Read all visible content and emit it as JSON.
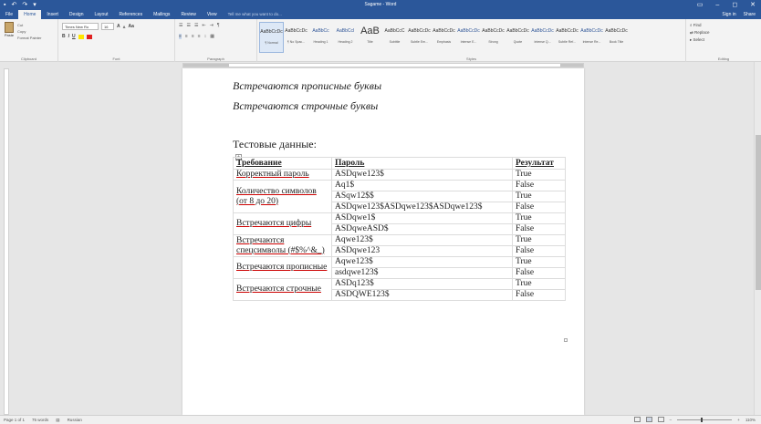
{
  "window": {
    "title": "Sagame - Word",
    "quick_access": [
      "▪",
      "↶",
      "↷",
      "▾"
    ],
    "account": {
      "sign_in": "Sign in",
      "share": "Share"
    },
    "controls": [
      "▭",
      "–",
      "◻",
      "✕"
    ]
  },
  "tabs": [
    "File",
    "Home",
    "Insert",
    "Design",
    "Layout",
    "References",
    "Mailings",
    "Review",
    "View"
  ],
  "active_tab": "Home",
  "tell_me_placeholder": "Tell me what you want to do...",
  "ribbon": {
    "clipboard": {
      "label": "Clipboard",
      "paste": "Paste",
      "cut": "Cut",
      "copy": "Copy",
      "format_painter": "Format Painter"
    },
    "font": {
      "label": "Font",
      "name": "Times New Ro",
      "size": "16",
      "grow": "A",
      "shrink": "A",
      "case": "Aa",
      "bold": "B",
      "italic": "I",
      "underline": "U"
    },
    "paragraph": {
      "label": "Paragraph",
      "pilcrow": "¶"
    },
    "styles": {
      "label": "Styles",
      "items": [
        {
          "preview": "AaBbCcDc",
          "name": "¶ Normal",
          "big": false,
          "blue": false
        },
        {
          "preview": "AaBbCcDc",
          "name": "¶ No Spac...",
          "big": false,
          "blue": false
        },
        {
          "preview": "AaBbCc",
          "name": "Heading 1",
          "big": false,
          "blue": true
        },
        {
          "preview": "AaBbCcI",
          "name": "Heading 2",
          "big": false,
          "blue": true
        },
        {
          "preview": "AaB",
          "name": "Title",
          "big": true,
          "blue": false
        },
        {
          "preview": "AaBbCcC",
          "name": "Subtitle",
          "big": false,
          "blue": false
        },
        {
          "preview": "AaBbCcDc",
          "name": "Subtle Em...",
          "big": false,
          "blue": false
        },
        {
          "preview": "AaBbCcDc",
          "name": "Emphasis",
          "big": false,
          "blue": false
        },
        {
          "preview": "AaBbCcDc",
          "name": "Intense E...",
          "big": false,
          "blue": true
        },
        {
          "preview": "AaBbCcDc",
          "name": "Strong",
          "big": false,
          "blue": false
        },
        {
          "preview": "AaBbCcDc",
          "name": "Quote",
          "big": false,
          "blue": false
        },
        {
          "preview": "AaBbCcDc",
          "name": "Intense Q...",
          "big": false,
          "blue": true
        },
        {
          "preview": "AaBbCcDc",
          "name": "Subtle Ref...",
          "big": false,
          "blue": false
        },
        {
          "preview": "AaBbCcDc",
          "name": "Intense Re...",
          "big": false,
          "blue": true
        },
        {
          "preview": "AaBbCcDc",
          "name": "Book Title",
          "big": false,
          "blue": false
        }
      ]
    },
    "editing": {
      "label": "Editing",
      "find": "Find",
      "replace": "Replace",
      "select": "Select"
    }
  },
  "document": {
    "lines": [
      "Встречаются прописные буквы",
      "Встречаются строчные буквы"
    ],
    "heading": "Тестовые данные:",
    "table": {
      "headers": [
        "Требование",
        "Пароль",
        "Результат"
      ],
      "groups": [
        {
          "requirement": "Корректный пароль",
          "rows": [
            [
              "ASDqwe123$",
              "True"
            ]
          ]
        },
        {
          "requirement": "Количество символов (от 8 до 20)",
          "rows": [
            [
              "Aq1$",
              "False"
            ],
            [
              "ASqw12$$",
              "True"
            ],
            [
              "ASDqwe123$ASDqwe123$ASDqwe123$",
              "False"
            ]
          ]
        },
        {
          "requirement": "Встречаются цифры",
          "rows": [
            [
              "ASDqwe1$",
              "True"
            ],
            [
              "ASDqweASD$",
              "False"
            ]
          ]
        },
        {
          "requirement": "Встречаются спецсимволы (#$%^&_)",
          "rows": [
            [
              "Aqwe123$",
              "True"
            ],
            [
              "ASDqwe123",
              "False"
            ]
          ]
        },
        {
          "requirement": "Встречаются прописные",
          "rows": [
            [
              "Aqwe123$",
              "True"
            ],
            [
              "asdqwe123$",
              "False"
            ]
          ]
        },
        {
          "requirement": "Встречаются строчные",
          "rows": [
            [
              "ASDq123$",
              "True"
            ],
            [
              "ASDQWE123$",
              "False"
            ]
          ]
        }
      ]
    }
  },
  "status": {
    "page": "Page 1 of 1",
    "words": "75 words",
    "language": "Russian",
    "zoom": "110%"
  },
  "colors": {
    "accent": "#2b579a",
    "spell_underline": "#cc0000"
  }
}
